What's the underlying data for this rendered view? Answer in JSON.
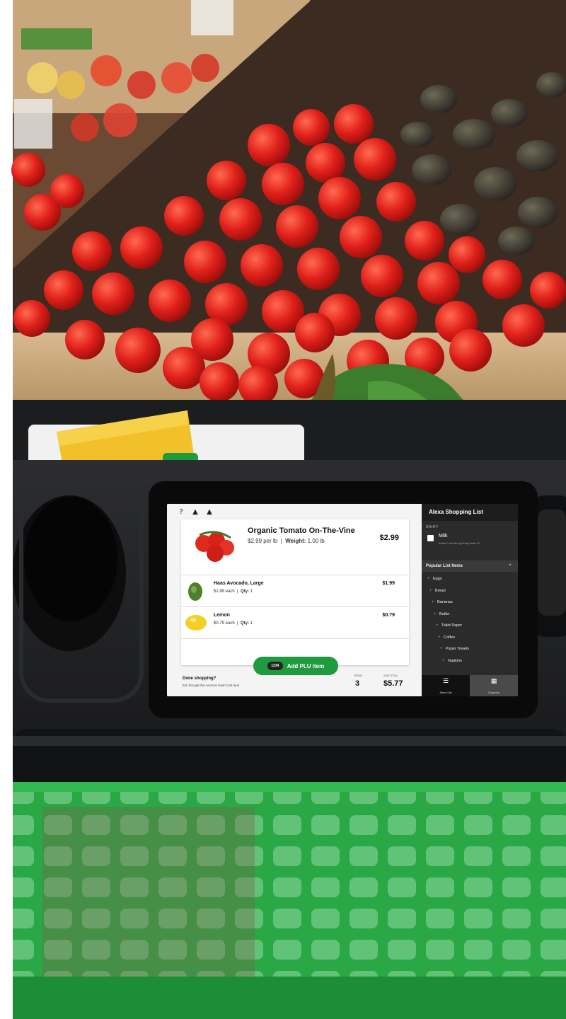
{
  "screen": {
    "top_icons": [
      "help-icon",
      "bell-icon",
      "bell-icon"
    ],
    "cart_items": [
      {
        "name": "Organic Tomato On-The-Vine",
        "unit_price": "$2.99 per lb",
        "detail_label": "Weight:",
        "detail_value": "1.00 lb",
        "price": "$2.99",
        "image": "tomato-image"
      },
      {
        "name": "Haas Avocado, Large",
        "unit_price": "$1.99 each",
        "detail_label": "Qty:",
        "detail_value": "1",
        "price": "$1.99",
        "image": "avocado-image"
      },
      {
        "name": "Lemon",
        "unit_price": "$0.79 each",
        "detail_label": "Qty:",
        "detail_value": "1",
        "price": "$0.79",
        "image": "lemon-image"
      }
    ],
    "add_plu": {
      "badge": "1234",
      "label": "Add PLU item"
    },
    "footer": {
      "done_title": "Done shopping?",
      "done_subtitle": "Exit through the Amazon Dash Cart lane",
      "items_label": "ITEMS",
      "items_count": "3",
      "subtotal_label": "SUBTOTAL",
      "subtotal": "$5.77"
    },
    "shopping_list": {
      "title": "Alexa Shopping List",
      "section": "DAIRY",
      "dairy_item": {
        "name": "Milk",
        "meta": "Added 1 minute ago  Dairy aisle 10"
      },
      "popular_header": "Popular List Items",
      "popular_items": [
        "Eggs",
        "Bread",
        "Bananas",
        "Butter",
        "Toilet Paper",
        "Coffee",
        "Paper Towels",
        "Napkins"
      ]
    },
    "tabs": [
      {
        "label": "Alexa List",
        "icon": "list-icon",
        "active": true
      },
      {
        "label": "Coupons",
        "icon": "coupon-icon",
        "active": false
      }
    ]
  },
  "colors": {
    "accent_green": "#1f9a3e",
    "list_bg": "#2b2b2b",
    "cart_body": "#1e1f21",
    "basket_green": "#2db34a"
  }
}
